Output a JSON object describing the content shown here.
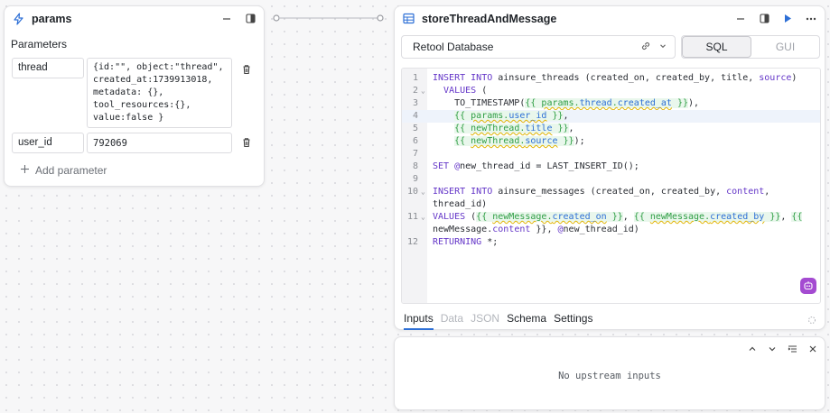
{
  "params_block": {
    "title": "params",
    "section_label": "Parameters",
    "params": [
      {
        "name": "thread",
        "value": "{id:\"\", object:\"thread\",\ncreated_at:1739913018,\nmetadata: {},\ntool_resources:{},\nvalue:false }"
      },
      {
        "name": "user_id",
        "value": "792069"
      }
    ],
    "add_label": "Add parameter"
  },
  "query_block": {
    "title": "storeThreadAndMessage",
    "resource": "Retool Database",
    "modes": [
      "SQL",
      "GUI"
    ],
    "active_mode": "SQL",
    "code_lines": [
      {
        "n": "1",
        "text": "INSERT INTO ainsure_threads (created_on, created_by, title, source)"
      },
      {
        "n": "2",
        "text": "  VALUES ("
      },
      {
        "n": "3",
        "text": "    TO_TIMESTAMP({{ params.thread.created_at }}),"
      },
      {
        "n": "4",
        "text": "    {{ params.user_id }},"
      },
      {
        "n": "5",
        "text": "    {{ newThread.title }},"
      },
      {
        "n": "6",
        "text": "    {{ newThread.source }});"
      },
      {
        "n": "7",
        "text": ""
      },
      {
        "n": "8",
        "text": "SET @new_thread_id = LAST_INSERT_ID();"
      },
      {
        "n": "9",
        "text": ""
      },
      {
        "n": "10",
        "text": "INSERT INTO ainsure_messages (created_on, created_by, content,"
      },
      {
        "n": "",
        "text": "thread_id)"
      },
      {
        "n": "11",
        "text": "VALUES ({{ newMessage.created_on }}, {{ newMessage.created_by }}, {{"
      },
      {
        "n": "",
        "text": "newMessage.content }}, @new_thread_id)"
      },
      {
        "n": "12",
        "text": "RETURNING *;"
      }
    ],
    "tabs": [
      "Inputs",
      "Data",
      "JSON",
      "Schema",
      "Settings"
    ],
    "active_tab": "Inputs",
    "disabled_tabs": [
      "Data",
      "JSON"
    ]
  },
  "inputs_panel": {
    "empty_message": "No upstream inputs"
  },
  "colors": {
    "keyword": "#6436c8",
    "template": "#2f9e44",
    "template_bg": "#e9f7ec",
    "accent": "#2d6fd6",
    "ai_badge": "#a44bd1"
  }
}
